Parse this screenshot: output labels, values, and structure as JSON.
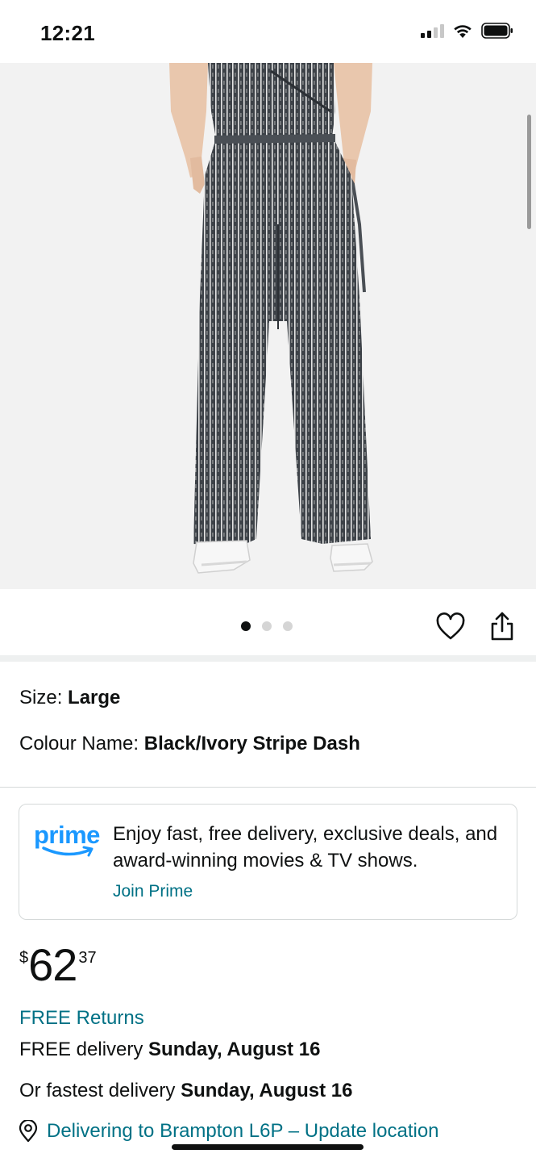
{
  "status_bar": {
    "time": "12:21"
  },
  "product_image": {
    "description_icon": "jumpsuit-product-photo",
    "image_count": 3,
    "active_image_index": 0
  },
  "variations": {
    "size_label": "Size: ",
    "size_value": "Large",
    "colour_label": "Colour Name: ",
    "colour_value": "Black/Ivory Stripe Dash"
  },
  "prime": {
    "logo_text": "prime",
    "message": "Enjoy fast, free delivery, exclusive deals, and award-winning movies & TV shows.",
    "link": "Join Prime"
  },
  "price": {
    "currency": "$",
    "whole": "62",
    "fraction": "37"
  },
  "returns": "FREE Returns",
  "delivery": {
    "free_prefix": "FREE delivery ",
    "free_date": "Sunday, August 16",
    "fastest_prefix": "Or fastest delivery ",
    "fastest_date": "Sunday, August 16"
  },
  "location": {
    "text": "Delivering to Brampton L6P – Update location"
  },
  "colors": {
    "link": "#007185",
    "prime_blue": "#1a98ff",
    "text": "#0f1111",
    "image_bg": "#f2f2f2"
  }
}
